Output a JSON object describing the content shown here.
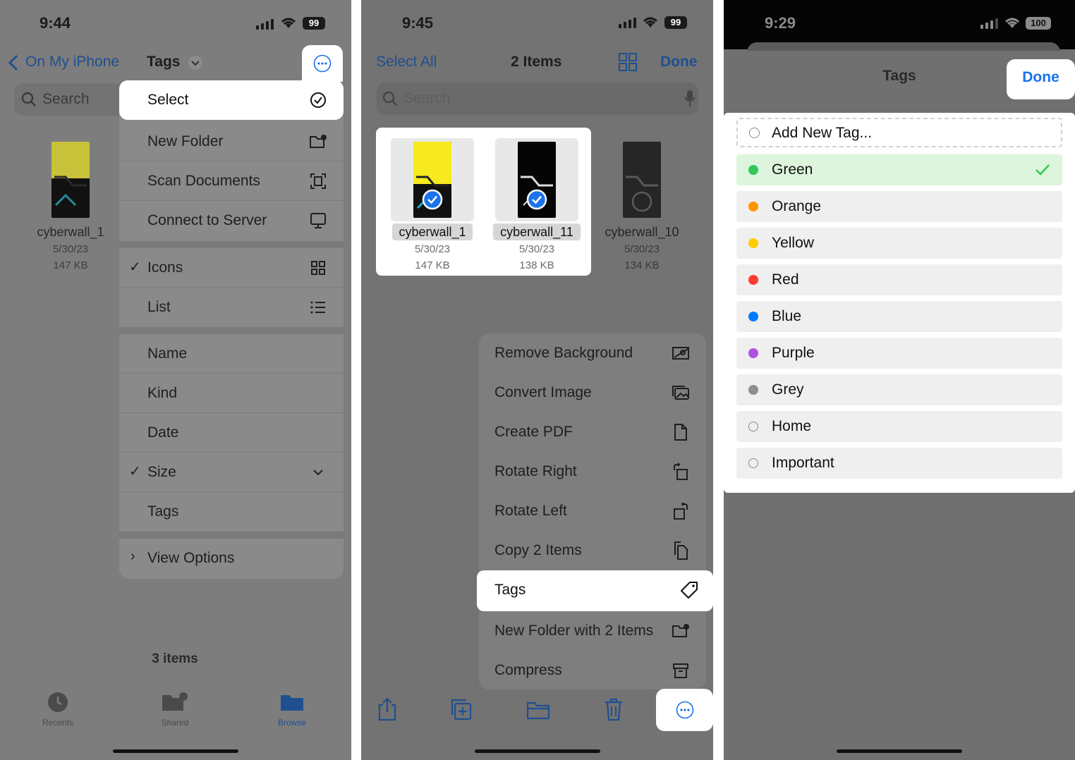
{
  "panel1": {
    "status": {
      "time": "9:44",
      "battery": "99"
    },
    "nav": {
      "back_label": "On My iPhone",
      "title": "Tags"
    },
    "search": {
      "placeholder": "Search"
    },
    "file": {
      "name": "cyberwall_1",
      "date": "5/30/23",
      "size": "147 KB"
    },
    "menu": {
      "items": [
        {
          "label": "Select",
          "icon": "checkmark-circle-icon"
        },
        {
          "label": "New Folder",
          "icon": "folder-badge-plus-icon"
        },
        {
          "label": "Scan Documents",
          "icon": "doc-viewfinder-icon"
        },
        {
          "label": "Connect to Server",
          "icon": "display-icon"
        },
        {
          "label": "Icons",
          "icon": "grid-icon",
          "checked": true
        },
        {
          "label": "List",
          "icon": "list-icon"
        },
        {
          "label": "Name"
        },
        {
          "label": "Kind"
        },
        {
          "label": "Date"
        },
        {
          "label": "Size",
          "checked": true,
          "icon": "chevron-down-icon"
        },
        {
          "label": "Tags"
        },
        {
          "label": "View Options",
          "icon": "chevron-right-icon"
        }
      ]
    },
    "footer": {
      "count": "3 items"
    },
    "tabs": [
      {
        "label": "Recents",
        "icon": "clock-icon"
      },
      {
        "label": "Shared",
        "icon": "shared-folder-icon"
      },
      {
        "label": "Browse",
        "icon": "folder-icon"
      }
    ]
  },
  "panel2": {
    "status": {
      "time": "9:45",
      "battery": "99"
    },
    "nav": {
      "select_all": "Select All",
      "title": "2 Items",
      "done": "Done"
    },
    "search": {
      "placeholder": "Search"
    },
    "files": [
      {
        "name": "cyberwall_1",
        "date": "5/30/23",
        "size": "147 KB",
        "selected": true
      },
      {
        "name": "cyberwall_11",
        "date": "5/30/23",
        "size": "138 KB",
        "selected": true
      },
      {
        "name": "cyberwall_10",
        "date": "5/30/23",
        "size": "134 KB",
        "selected": false
      }
    ],
    "menu": {
      "items": [
        {
          "label": "Remove Background",
          "icon": "remove-background-icon"
        },
        {
          "label": "Convert Image",
          "icon": "photo-stack-icon"
        },
        {
          "label": "Create PDF",
          "icon": "document-icon"
        },
        {
          "label": "Rotate Right",
          "icon": "rotate-right-icon"
        },
        {
          "label": "Rotate Left",
          "icon": "rotate-left-icon"
        },
        {
          "label": "Copy 2 Items",
          "icon": "copy-doc-icon"
        },
        {
          "label": "Tags",
          "icon": "tag-icon"
        },
        {
          "label": "New Folder with 2 Items",
          "icon": "folder-badge-plus-icon"
        },
        {
          "label": "Compress",
          "icon": "archive-box-icon"
        }
      ]
    },
    "toolbar": [
      "share-icon",
      "duplicate-icon",
      "folder-icon",
      "trash-icon",
      "more-icon"
    ]
  },
  "panel3": {
    "status": {
      "time": "9:29",
      "battery": "100"
    },
    "sheet": {
      "title": "Tags",
      "done": "Done"
    },
    "add_new": "Add New Tag...",
    "tags": [
      {
        "label": "Green",
        "color": "#34c759",
        "selected": true
      },
      {
        "label": "Orange",
        "color": "#ff9500"
      },
      {
        "label": "Yellow",
        "color": "#ffcc00"
      },
      {
        "label": "Red",
        "color": "#ff3b30"
      },
      {
        "label": "Blue",
        "color": "#007aff"
      },
      {
        "label": "Purple",
        "color": "#af52de"
      },
      {
        "label": "Grey",
        "color": "#8e8e93"
      },
      {
        "label": "Home",
        "color": ""
      },
      {
        "label": "Important",
        "color": ""
      }
    ]
  },
  "colors": {
    "accent": "#1a73e8",
    "selected_tag_bg": "#def5dd",
    "check_green": "#34c759"
  }
}
